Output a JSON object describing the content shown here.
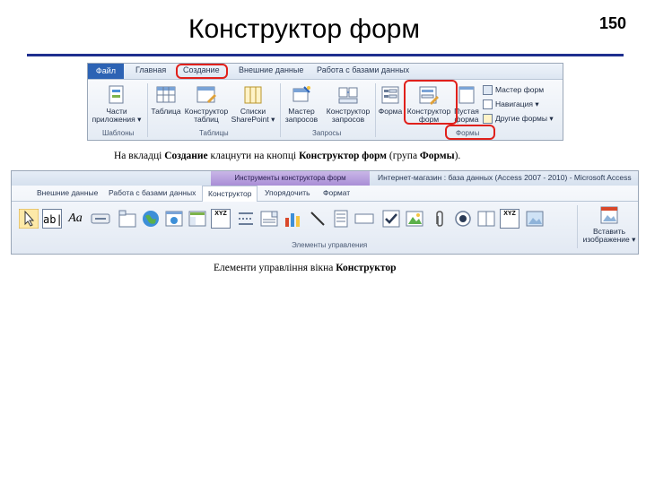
{
  "slide": {
    "title": "Конструктор форм",
    "page_number": "150"
  },
  "ribbon1": {
    "tabs": [
      "Файл",
      "Главная",
      "Создание",
      "Внешние данные",
      "Работа с базами данных"
    ],
    "buttons": {
      "parts": "Части\nприложения ▾",
      "table": "Таблица",
      "table_designer": "Конструктор\nтаблиц",
      "sharepoint": "Списки\nSharePoint ▾",
      "query_wizard": "Мастер\nзапросов",
      "query_designer": "Конструктор\nзапросов",
      "form": "Форма",
      "form_designer": "Конструктор\nформ",
      "blank_form": "Пустая\nформа",
      "form_wizard": "Мастер форм",
      "navigation": "Навигация ▾",
      "other_forms": "Другие формы ▾"
    },
    "groups": [
      "Шаблоны",
      "Таблицы",
      "Запросы",
      "Формы"
    ]
  },
  "caption1": {
    "p1": "На вкладці ",
    "b1": "Создание",
    "p2": " клацнути на кнопці ",
    "b2": "Конструктор форм",
    "p3": " (група ",
    "b3": "Формы",
    "p4": ")."
  },
  "ribbon2": {
    "context_title": "Инструменты конструктора форм",
    "window_title": "Интернет-магазин : база данных (Access 2007 - 2010) - Microsoft Access",
    "tabs": [
      "Внешние данные",
      "Работа с базами данных",
      "Конструктор",
      "Упорядочить",
      "Формат"
    ],
    "controls": {
      "label": "Aa",
      "textbox": "ab|",
      "xyz": "XYZ"
    },
    "insert_image": "Вставить\nизображение ▾",
    "group_label": "Элементы управления"
  },
  "caption2": {
    "p1": "Елементи управління вікна ",
    "b1": "Конструктор"
  },
  "colors": {
    "highlight": "#e0201b",
    "title_rule": "#1f2f8f",
    "file_tab": "#2d63b4",
    "context_tab": "#a98ed6"
  }
}
